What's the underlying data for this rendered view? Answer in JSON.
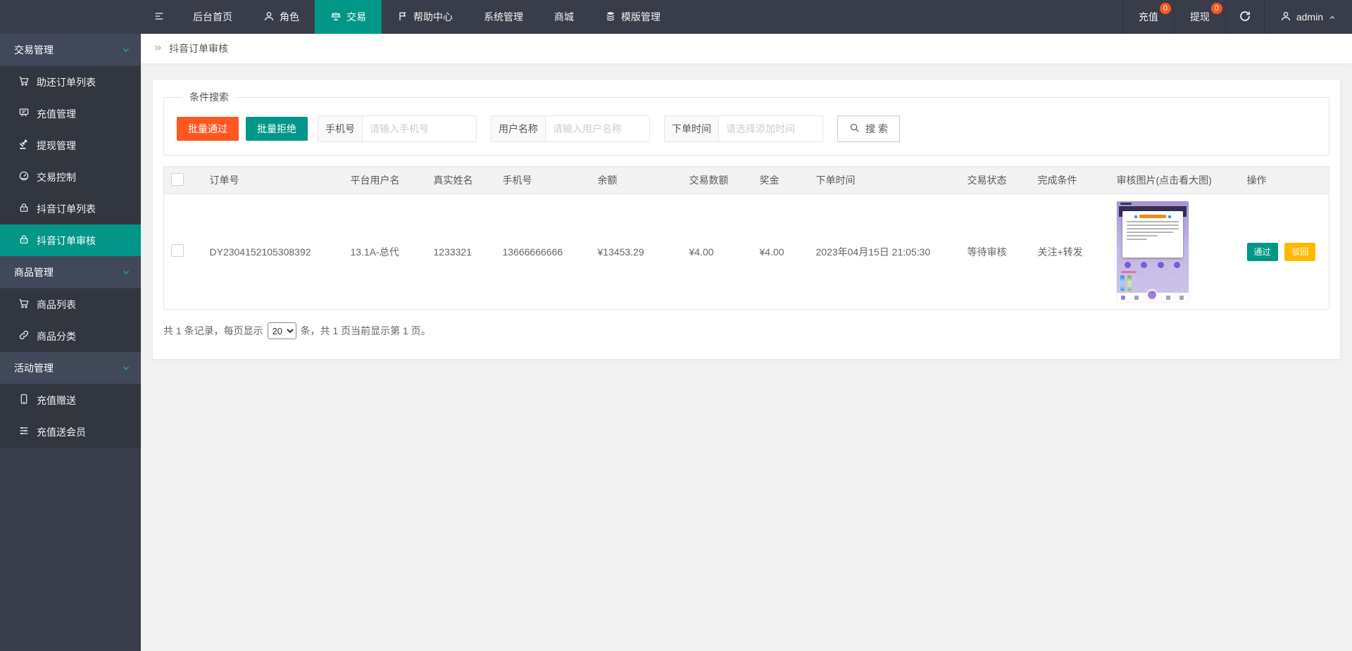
{
  "navbar": {
    "menu": [
      {
        "label": "后台首页"
      },
      {
        "label": "角色"
      },
      {
        "label": "交易"
      },
      {
        "label": "帮助中心"
      },
      {
        "label": "系统管理"
      },
      {
        "label": "商城"
      },
      {
        "label": "模版管理"
      }
    ],
    "recharge_label": "充值",
    "recharge_badge": "0",
    "withdraw_label": "提现",
    "withdraw_badge": "0",
    "username": "admin"
  },
  "sidebar": {
    "groups": [
      {
        "label": "交易管理",
        "items": [
          {
            "label": "助还订单列表"
          },
          {
            "label": "充值管理"
          },
          {
            "label": "提现管理"
          },
          {
            "label": "交易控制"
          },
          {
            "label": "抖音订单列表"
          },
          {
            "label": "抖音订单审核"
          }
        ]
      },
      {
        "label": "商品管理",
        "items": [
          {
            "label": "商品列表"
          },
          {
            "label": "商品分类"
          }
        ]
      },
      {
        "label": "活动管理",
        "items": [
          {
            "label": "充值赠送"
          },
          {
            "label": "充值送会员"
          }
        ]
      }
    ]
  },
  "breadcrumb": {
    "title": "抖音订单审核"
  },
  "search": {
    "legend": "条件搜索",
    "batch_approve": "批量通过",
    "batch_reject": "批量拒绝",
    "phone_label": "手机号",
    "phone_placeholder": "请输入手机号",
    "username_label": "用户名称",
    "username_placeholder": "请输入用户名称",
    "time_label": "下单时间",
    "time_placeholder": "请选择添加时间",
    "search_button": "搜 索"
  },
  "table": {
    "headers": [
      "订单号",
      "平台用户名",
      "真实姓名",
      "手机号",
      "余额",
      "交易数额",
      "奖金",
      "下单时间",
      "交易状态",
      "完成条件",
      "审核图片(点击看大图)",
      "操作"
    ],
    "rows": [
      {
        "order_no": "DY2304152105308392",
        "platform_user": "13.1A-总代",
        "real_name": "1233321",
        "phone": "13666666666",
        "balance": "¥13453.29",
        "amount": "¥4.00",
        "bonus": "¥4.00",
        "order_time": "2023年04月15日 21:05:30",
        "status": "等待审核",
        "condition": "关注+转发",
        "approve_label": "通过",
        "reject_label": "驳回"
      }
    ]
  },
  "pagination": {
    "prefix": "共 1 条记录，每页显示",
    "page_size": "20",
    "suffix": "条，共 1 页当前显示第 1 页。"
  },
  "colors": {
    "accent_teal": "#009688",
    "accent_orange": "#FF5722",
    "accent_yellow": "#FFB800",
    "navbar_bg": "#393D49"
  }
}
